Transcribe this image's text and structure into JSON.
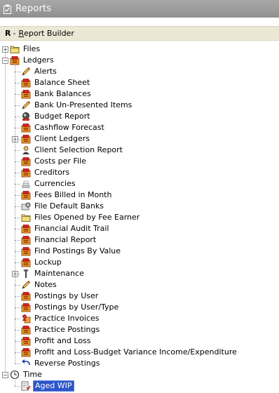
{
  "window": {
    "title": "Reports",
    "icon": "report-icon"
  },
  "subheader": {
    "key": "R",
    "separator": "-",
    "label_first": "R",
    "label_rest": "eport Builder"
  },
  "tree": {
    "files": {
      "label": "Files",
      "icon": "folder-icon",
      "state": "collapsed"
    },
    "ledgers": {
      "label": "Ledgers",
      "icon": "ledger-report-icon",
      "state": "expanded",
      "items": [
        {
          "label": "Alerts",
          "icon": "pencil-icon"
        },
        {
          "label": "Balance Sheet",
          "icon": "ledger-report-icon"
        },
        {
          "label": "Bank Balances",
          "icon": "ledger-report-icon"
        },
        {
          "label": "Bank Un-Presented Items",
          "icon": "pencil-icon"
        },
        {
          "label": "Budget Report",
          "icon": "budget-icon"
        },
        {
          "label": "Cashflow Forecast",
          "icon": "ledger-report-icon"
        },
        {
          "label": "Client Ledgers",
          "icon": "ledger-report-icon",
          "expandable": true
        },
        {
          "label": "Client Selection Report",
          "icon": "person-icon"
        },
        {
          "label": "Costs per File",
          "icon": "ledger-report-icon"
        },
        {
          "label": "Creditors",
          "icon": "ledger-report-icon"
        },
        {
          "label": "Currencies",
          "icon": "currency-icon"
        },
        {
          "label": "Fees Billed in Month",
          "icon": "ledger-report-icon"
        },
        {
          "label": "File Default Banks",
          "icon": "bank-settings-icon"
        },
        {
          "label": "Files Opened by Fee Earner",
          "icon": "folder-icon"
        },
        {
          "label": "Financial Audit Trail",
          "icon": "ledger-report-icon"
        },
        {
          "label": "Financial Report",
          "icon": "ledger-report-icon"
        },
        {
          "label": "Find Postings By Value",
          "icon": "ledger-report-icon"
        },
        {
          "label": "Lockup",
          "icon": "ledger-report-icon"
        },
        {
          "label": "Maintenance",
          "icon": "wrench-icon",
          "expandable": true
        },
        {
          "label": "Notes",
          "icon": "pencil-icon"
        },
        {
          "label": "Postings by User",
          "icon": "ledger-report-icon"
        },
        {
          "label": "Postings by User/Type",
          "icon": "ledger-report-icon"
        },
        {
          "label": "Practice Invoices",
          "icon": "invoice-person-icon"
        },
        {
          "label": "Practice Postings",
          "icon": "ledger-report-icon"
        },
        {
          "label": "Profit and Loss",
          "icon": "ledger-report-icon"
        },
        {
          "label": "Profit and Loss-Budget Variance Income/Expenditure",
          "icon": "ledger-report-icon"
        },
        {
          "label": "Reverse Postings",
          "icon": "undo-arrow-icon"
        }
      ]
    },
    "time": {
      "label": "Time",
      "icon": "clock-icon",
      "state": "expanded",
      "items": [
        {
          "label": "Aged WIP",
          "icon": "report-check-icon",
          "selected": true
        }
      ]
    }
  },
  "colors": {
    "titlebar": "#9c9c9c",
    "subheader": "#ece8d6",
    "selection": "#2c55c8"
  }
}
